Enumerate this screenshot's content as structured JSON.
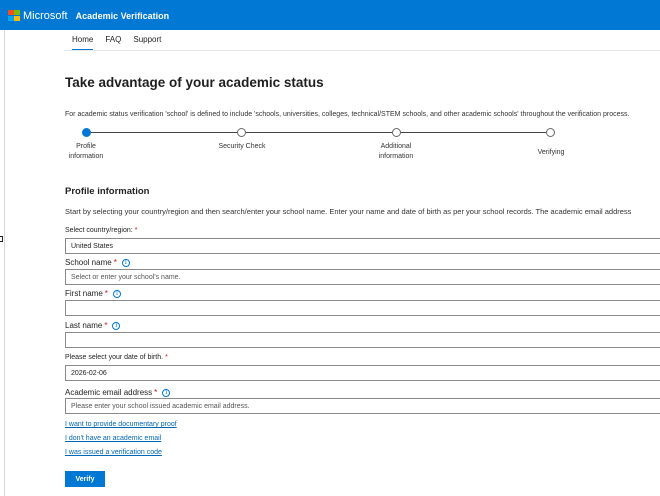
{
  "header": {
    "brand": "Microsoft",
    "product": "Academic Verification",
    "logo_colors": [
      "#f25022",
      "#7fba00",
      "#00a4ef",
      "#ffb900"
    ]
  },
  "nav": {
    "items": [
      "Home",
      "FAQ",
      "Support"
    ],
    "active": "Home"
  },
  "page": {
    "title": "Take advantage of your academic status",
    "intro": "For academic status verification 'school' is defined to include 'schools, universities, colleges, technical/STEM schools, and other academic schools' throughout the verification process."
  },
  "stepper": {
    "steps": [
      {
        "label": "Profile information",
        "active": true
      },
      {
        "label": "Security Check",
        "active": false
      },
      {
        "label": "Additional information",
        "active": false
      },
      {
        "label": "Verifying",
        "active": false
      }
    ]
  },
  "profile": {
    "section_title": "Profile information",
    "description": "Start by selecting your country/region and then search/enter your school name. Enter your name and date of birth as per your school records. The academic email address",
    "country_label": "Select country/region:",
    "country_value": "United States",
    "school_label": "School name",
    "school_placeholder": "Select or enter your school's name.",
    "first_name_label": "First name",
    "last_name_label": "Last name",
    "dob_label": "Please select your date of birth.",
    "dob_value": "2026-02-06",
    "email_label": "Academic email address",
    "email_placeholder": "Please enter your school issued academic email address.",
    "required_mark": "*",
    "info_glyph": "i"
  },
  "links": {
    "documentary_proof": "I want to provide documentary proof",
    "no_email": "I don't have an academic email",
    "have_code": "I was issued a verification code"
  },
  "actions": {
    "verify": "Verify"
  },
  "colors": {
    "accent": "#0078d4",
    "required": "#c50f1f",
    "link": "#0067b8"
  }
}
